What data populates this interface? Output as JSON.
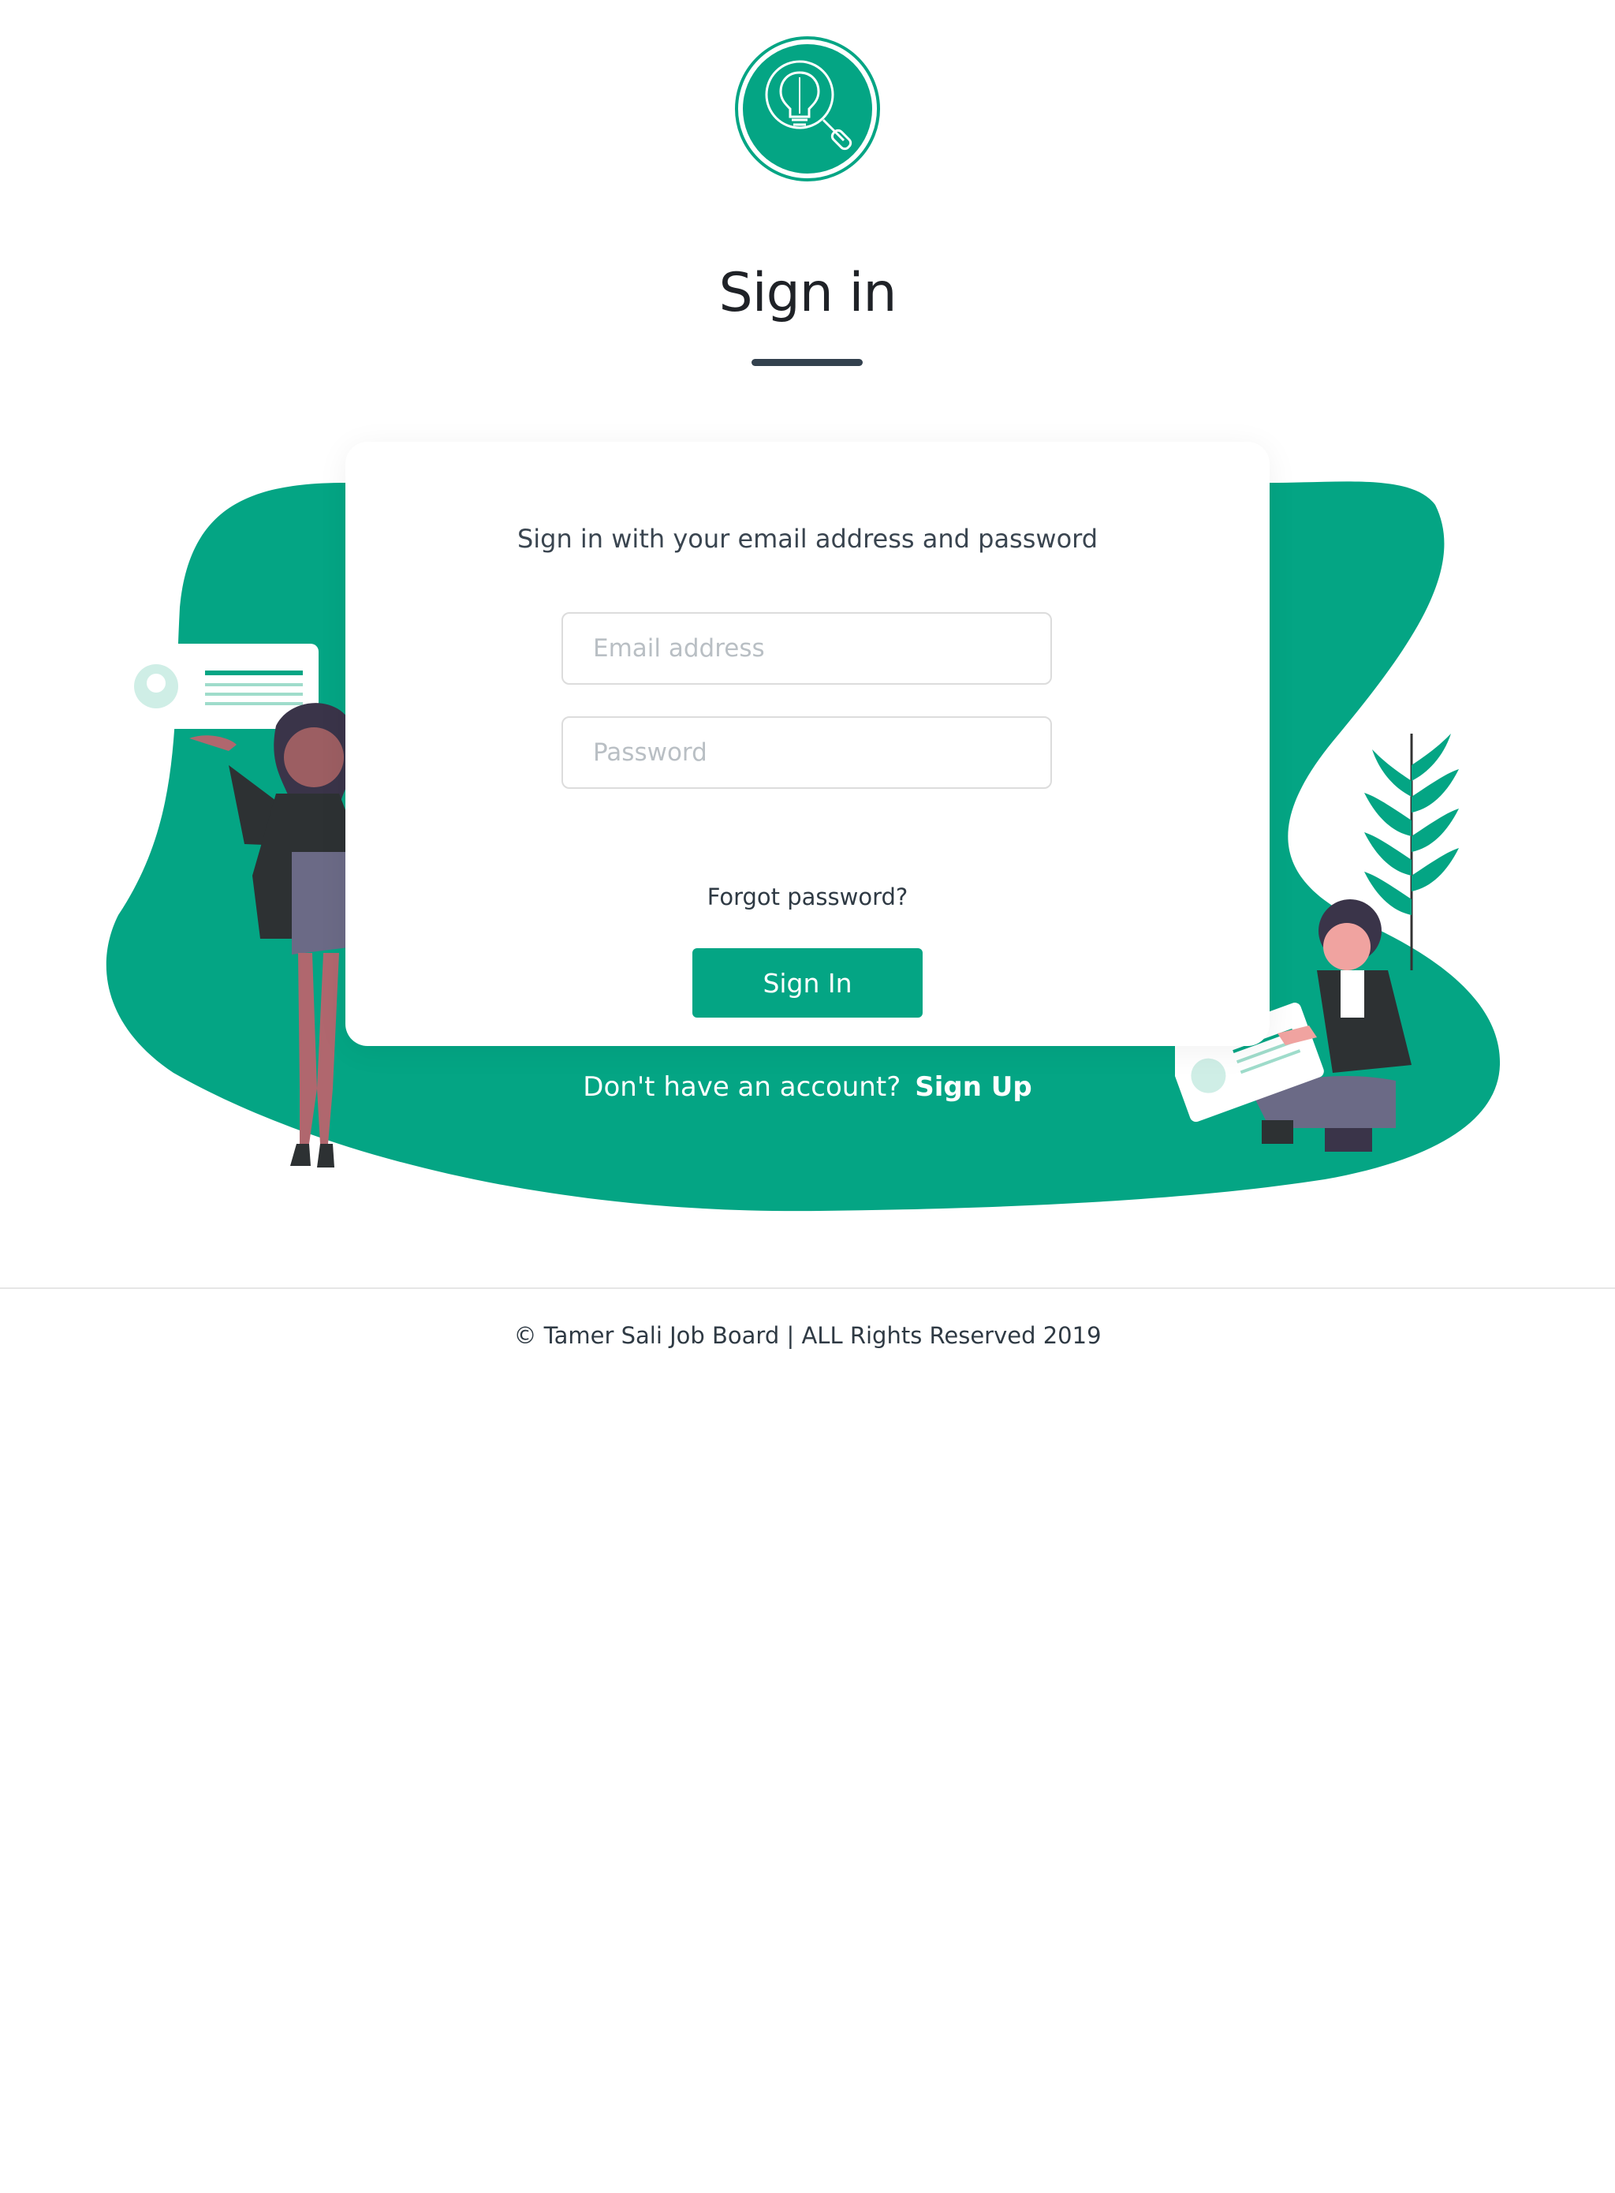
{
  "brand": {
    "logo_icon": "lightbulb-magnifier-icon",
    "accent_color": "#04a584",
    "title_underline_color": "#33414e"
  },
  "page": {
    "title": "Sign in"
  },
  "form": {
    "subtitle": "Sign in with your email address and password",
    "email_placeholder": "Email address",
    "email_value": "",
    "password_placeholder": "Password",
    "password_value": "",
    "forgot_label": "Forgot password?",
    "submit_label": "Sign In"
  },
  "signup": {
    "prompt": "Don't have an account?",
    "link_label": "Sign Up"
  },
  "footer": {
    "text": "© Tamer Sali Job Board | ALL Rights Reserved 2019"
  }
}
